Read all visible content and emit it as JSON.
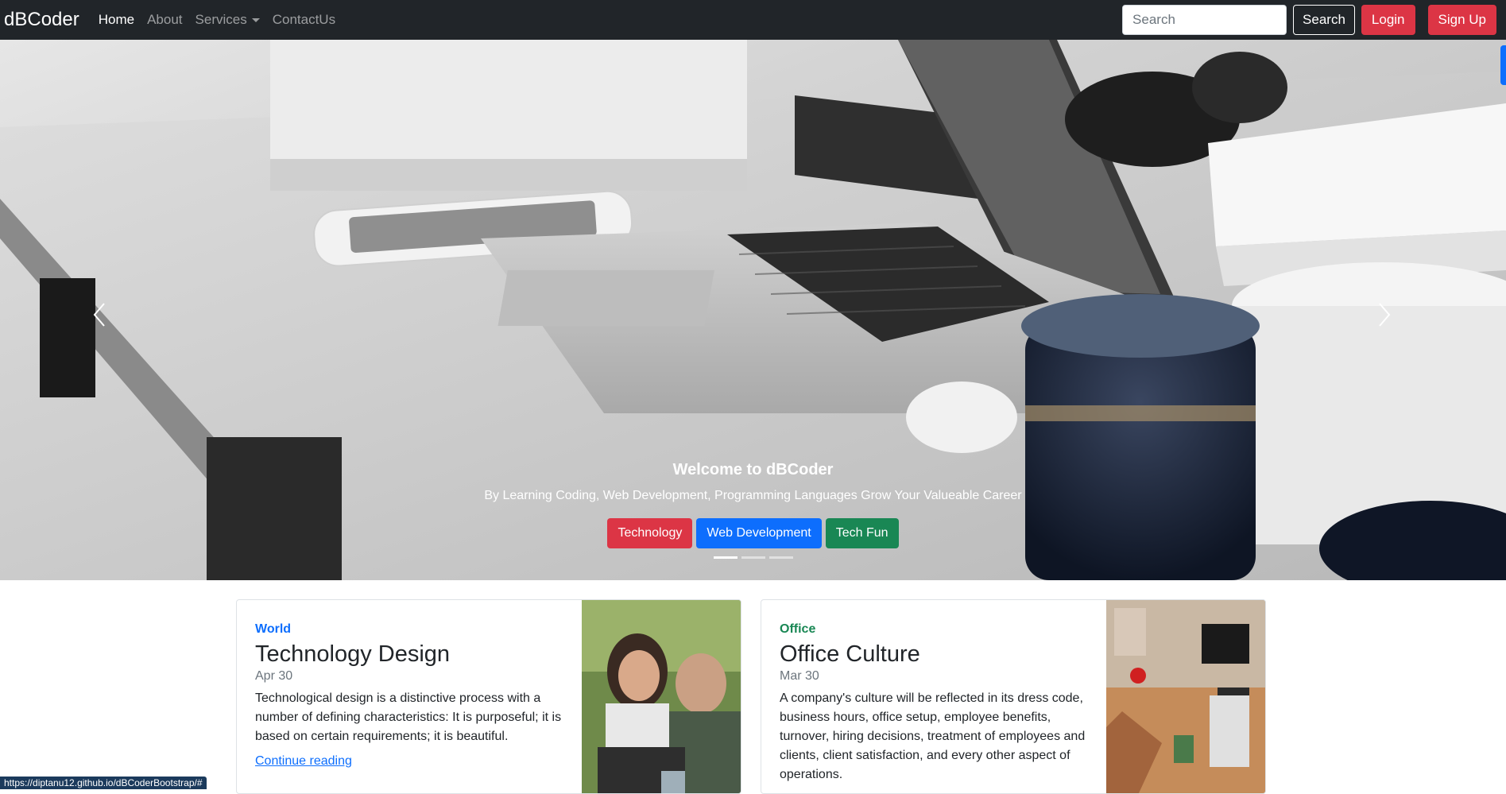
{
  "navbar": {
    "brand": "dBCoder",
    "links": [
      {
        "label": "Home",
        "active": true
      },
      {
        "label": "About"
      },
      {
        "label": "Services",
        "dropdown": true
      },
      {
        "label": "ContactUs"
      }
    ],
    "search_placeholder": "Search",
    "search_button": "Search",
    "login_button": "Login",
    "signup_button": "Sign Up"
  },
  "hero": {
    "title": "Welcome to dBCoder",
    "subtitle": "By Learning Coding, Web Development, Programming Languages Grow Your Valueable Career",
    "buttons": [
      {
        "label": "Technology",
        "color": "#dc3545"
      },
      {
        "label": "Web Development",
        "color": "#0d6efd"
      },
      {
        "label": "Tech Fun",
        "color": "#198754"
      }
    ],
    "indicators": 3,
    "active_indicator": 0
  },
  "cards": [
    {
      "category": "World",
      "category_color": "#0d6efd",
      "title": "Technology Design",
      "date": "Apr 30",
      "text": "Technological design is a distinctive process with a number of defining characteristics: It is purposeful; it is based on certain requirements; it is beautiful.",
      "link": "Continue reading"
    },
    {
      "category": "Office",
      "category_color": "#198754",
      "title": "Office Culture",
      "date": "Mar 30",
      "text": "A company's culture will be reflected in its dress code, business hours, office setup, employee benefits, turnover, hiring decisions, treatment of employees and clients, client satisfaction, and every other aspect of operations."
    }
  ],
  "status_url": "https://diptanu12.github.io/dBCoderBootstrap/#"
}
